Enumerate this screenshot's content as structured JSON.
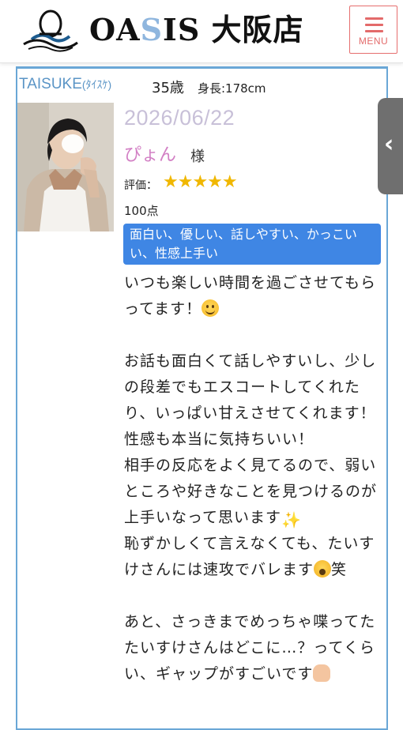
{
  "header": {
    "brand_prefix": "OA",
    "brand_accent": "S",
    "brand_suffix": "IS 大阪店",
    "menu_label": "MENU",
    "accent_color": "#e36a6a"
  },
  "cast": {
    "name": "TAISUKE",
    "name_kana": "(ﾀｲｽｹ)",
    "age": "35歳",
    "height": "身長:178cm"
  },
  "review": {
    "date": "2026/06/22",
    "customer": "ぴょん",
    "customer_suffix": "様",
    "rating_label": "評価：",
    "stars": "★★★★★",
    "rating_value": 5,
    "score": "100点",
    "tags": "面白い、優しい、話しやすい、かっこいい、性感上手い",
    "paragraphs": [
      "いつも楽しい時間を過ごさせてもらってます！",
      "お話も面白くて話しやすいし、少しの段差でもエスコートしてくれたり、いっぱい甘えさせてくれます！\n性感も本当に気持ちいい！\n相手の反応をよく見てるので、弱いところや好きなことを見つけるのが上手いなって思います",
      "恥ずかしくて言えなくても、たいすけさんには速攻でバレます",
      "笑",
      "あと、さっきまでめっちゃ喋ってたたいすけさんはどこに…？ってくらい、ギャップがすごいです"
    ]
  },
  "icons": {
    "logo": "oasis-wave-logo-icon",
    "side_toggle": "chevron-left-icon",
    "emoji_1": "smiling-face-icon",
    "emoji_2": "sparkles-icon",
    "emoji_3": "shocked-face-icon",
    "emoji_4": "hands-icon"
  }
}
